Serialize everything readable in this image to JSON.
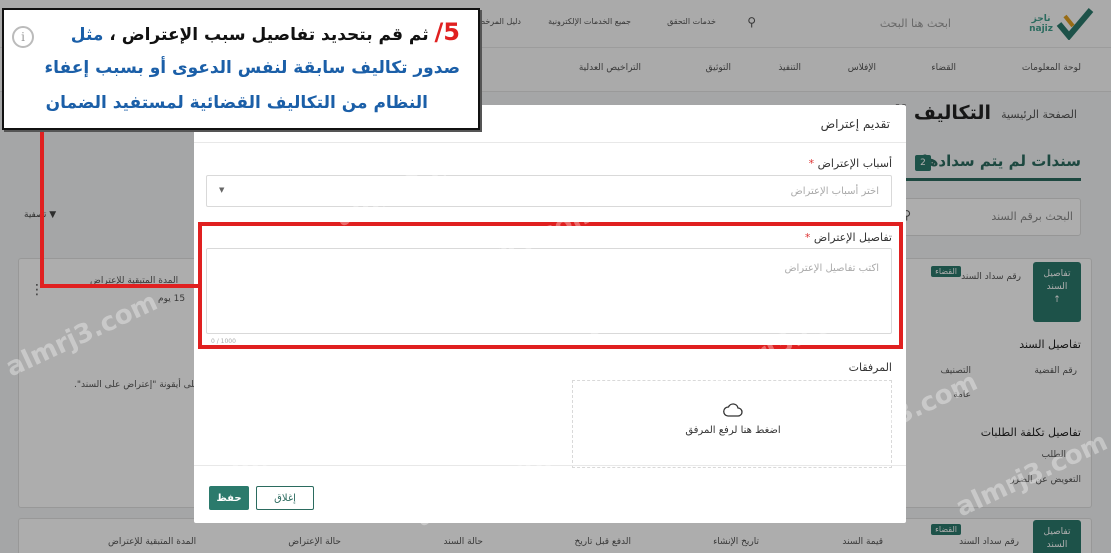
{
  "header": {
    "logo_text": "ناجز\nnajiz",
    "search_placeholder": "ابحث هنا البحث",
    "top_links": [
      "خدمات التحقق",
      "جميع الخدمات الإلكترونية",
      "دليل المرخصين"
    ]
  },
  "nav": [
    "لوحة المعلومات",
    "القضاء",
    "الإفلاس",
    "التنفيذ",
    "التوثيق",
    "التراخيص العدلية"
  ],
  "page": {
    "breadcrumb": "الصفحة الرئيسية",
    "title": "التكاليف القضـ",
    "tab_active": "سندات لم يتم سدادها",
    "tab_badge": "2",
    "search_placeholder": "البحث برقم السند",
    "filter_label": "تصفية"
  },
  "background_card": {
    "side_tab": "تفاصيل السند",
    "badge": "القضاء",
    "bond_number": "رقم سداد السند",
    "remaining_label": "المدة المتبقية للإعتراض",
    "remaining_value": "15 يوم",
    "details_heading": "تفاصيل السند",
    "case_number_label": "رقم القضية",
    "classification_label": "التصنيف",
    "classification_value": "عامة",
    "hint_text": "على أيقونة \"إعتراض على السند\".",
    "cost_heading": "تفاصيل تكلفة الطلبات",
    "request_label": "الطلب",
    "request_value": "التعويض عن الضرر"
  },
  "bottom_row": {
    "side_tab": "تفاصيل السند",
    "badge": "القضاء",
    "columns": [
      "رقم سداد السند",
      "قيمة السند",
      "تاريخ الإنشاء",
      "الدفع قبل تاريخ",
      "حالة السند",
      "حالة الإعتراض",
      "المدة المتبقية للإعتراض"
    ]
  },
  "modal": {
    "title": "تقديم إعتراض",
    "reasons_label": "أسباب الإعتراض",
    "reasons_placeholder": "اختر أسباب الإعتراض",
    "details_label": "تفاصيل الإعتراض",
    "details_placeholder": "اكتب تفاصيل الإعتراض",
    "counter": "1000 / 0",
    "attachments_label": "المرفقات",
    "upload_text": "اضغط هنا لرفع المرفق",
    "save_label": "حفظ",
    "close_label": "إغلاق",
    "required_mark": "*"
  },
  "callout": {
    "number": "5/",
    "line1": "ثم قم بتحديد تفاصيل سبب الإعتراض ، ",
    "line1_tail": "مثل",
    "line2": "صدور تكاليف سابقة لنفس الدعوى أو بسبب إعفاء",
    "line3": "النظام من التكاليف القضائية لمستفيد الضمان"
  },
  "watermark": "almrj3.com",
  "colors": {
    "brand": "#2b7a6c",
    "highlight": "#e02020",
    "callout_text": "#1b5fa8"
  }
}
